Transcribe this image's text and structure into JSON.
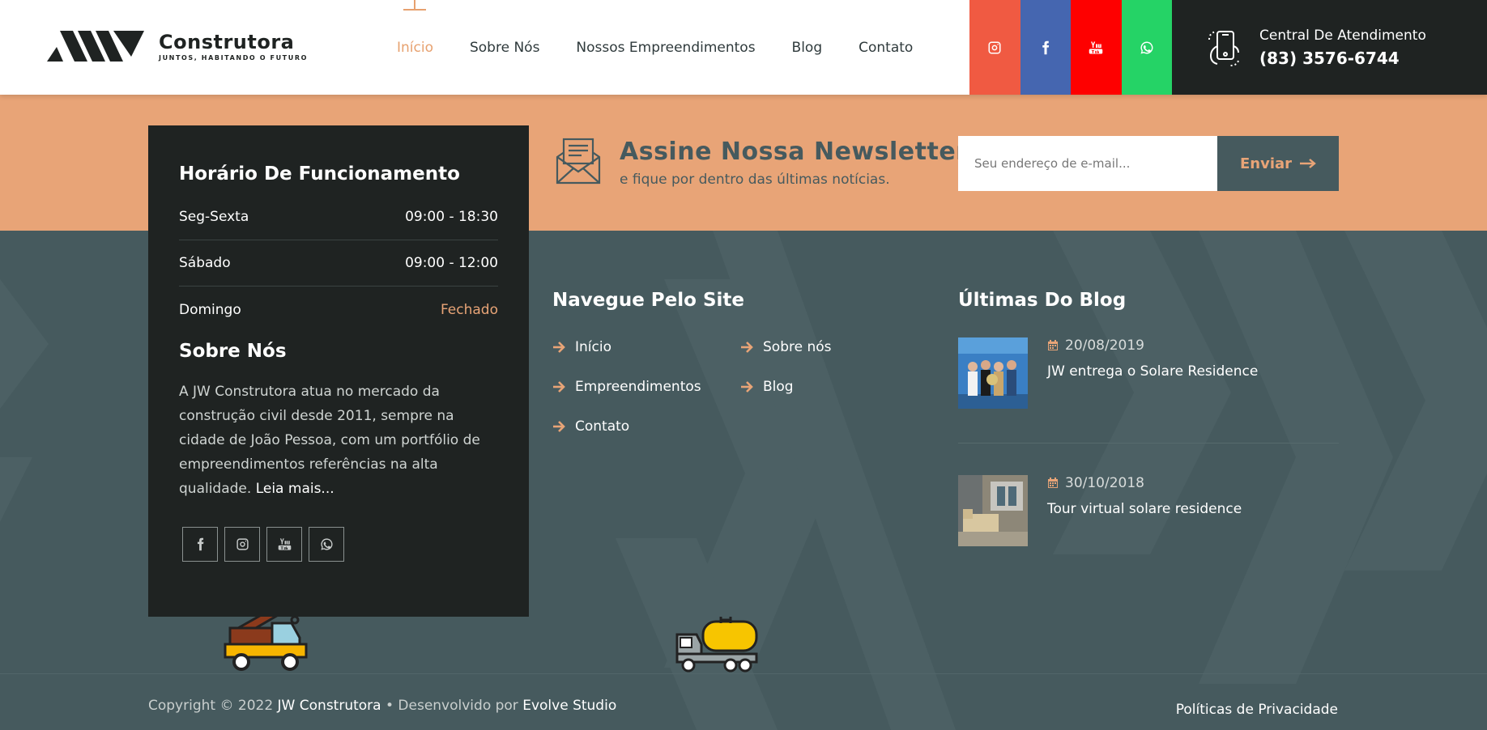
{
  "brand": {
    "name": "Construtora",
    "tagline": "JUNTOS, HABITANDO O FUTURO"
  },
  "nav": {
    "items": [
      {
        "label": "Início",
        "active": true
      },
      {
        "label": "Sobre Nós"
      },
      {
        "label": "Nossos Empreendimentos"
      },
      {
        "label": "Blog"
      },
      {
        "label": "Contato"
      }
    ]
  },
  "social": {
    "icons": [
      "instagram-icon",
      "facebook-icon",
      "youtube-icon",
      "whatsapp-icon"
    ],
    "colors": {
      "instagram": "#f05a42",
      "facebook": "#4566b0",
      "youtube": "#fe0000",
      "whatsapp": "#25d366"
    }
  },
  "callcenter": {
    "label": "Central De Atendimento",
    "phone": "(83) 3576-6744"
  },
  "newsletter": {
    "title": "Assine Nossa Newsletter",
    "subtitle": "e fique por dentro das últimas notícias.",
    "placeholder": "Seu endereço de e-mail...",
    "button": "Enviar"
  },
  "hours": {
    "title": "Horário De Funcionamento",
    "rows": [
      {
        "day": "Seg-Sexta",
        "time": "09:00 - 18:30"
      },
      {
        "day": "Sábado",
        "time": "09:00 - 12:00"
      },
      {
        "day": "Domingo",
        "time": "Fechado"
      }
    ]
  },
  "about": {
    "title": "Sobre Nós",
    "text": "A JW Construtora atua no mercado da construção civil desde 2011, sempre na cidade de João Pessoa, com um portfólio de empreendimentos referências na alta qualidade.",
    "more": "Leia mais..."
  },
  "sitenav": {
    "title": "Navegue Pelo Site",
    "links": [
      "Início",
      "Sobre nós",
      "Empreendimentos",
      "Blog",
      "Contato"
    ]
  },
  "blog": {
    "title": "Últimas Do Blog",
    "posts": [
      {
        "date": "20/08/2019",
        "title": "JW entrega o Solare Residence"
      },
      {
        "date": "30/10/2018",
        "title": "Tour virtual solare residence"
      }
    ]
  },
  "footer": {
    "copyright_prefix": "Copyright © 2022",
    "company": "JW Construtora",
    "dev_prefix": "• Desenvolvido por",
    "studio": "Evolve Studio",
    "privacy": "Políticas de Privacidade"
  },
  "colors": {
    "accent": "#e8a477",
    "dark": "#1f2322",
    "slate": "#465a5e"
  }
}
